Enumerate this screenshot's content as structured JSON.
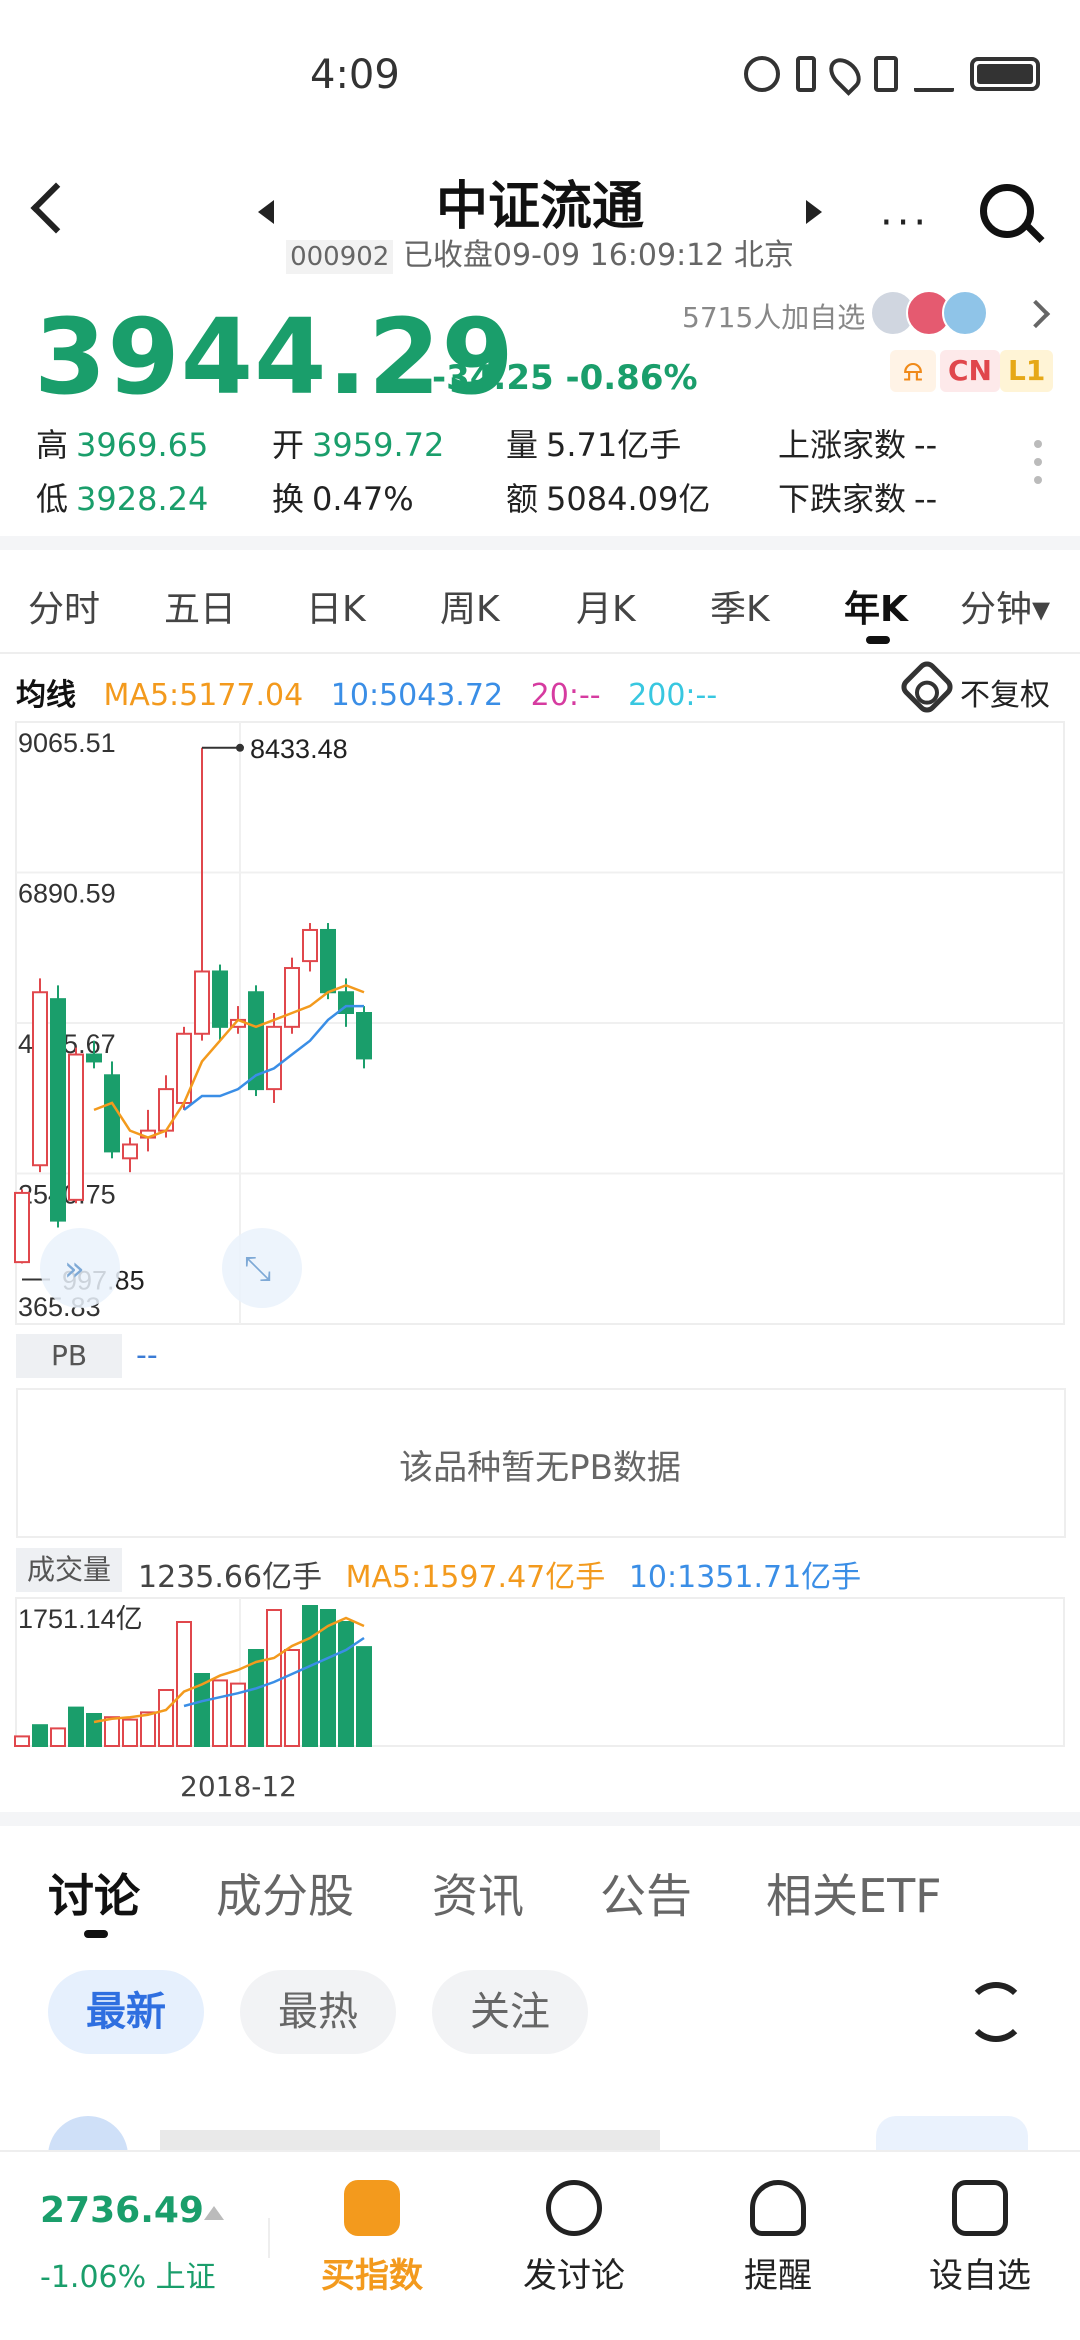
{
  "status_bar": {
    "time": "4:09",
    "icons": [
      "eye-icon",
      "bluetooth-icon",
      "location-icon",
      "vibrate-icon",
      "signal-5g-icon",
      "battery-icon"
    ]
  },
  "header": {
    "title": "中证流通",
    "code": "000902",
    "status": "已收盘09-09 16:09:12 北京",
    "more_label": "···"
  },
  "quote": {
    "price": "3944.29",
    "change": "-34.25 -0.86%",
    "followers": "5715人加自选",
    "tags": [
      "CN",
      "L1"
    ],
    "stats": [
      {
        "label": "高",
        "value": "3969.65"
      },
      {
        "label": "开",
        "value": "3959.72"
      },
      {
        "label": "量",
        "value": "5.71亿手"
      },
      {
        "label": "上涨家数",
        "value": "--"
      },
      {
        "label": "低",
        "value": "3928.24"
      },
      {
        "label": "换",
        "value": "0.47%"
      },
      {
        "label": "额",
        "value": "5084.09亿"
      },
      {
        "label": "下跌家数",
        "value": "--"
      }
    ]
  },
  "period_tabs": [
    "分时",
    "五日",
    "日K",
    "周K",
    "月K",
    "季K",
    "年K",
    "分钟▾"
  ],
  "ma_legend": {
    "title": "均线",
    "ma5": "MA5:5177.04",
    "ma10": "10:5043.72",
    "ma20": "20:--",
    "ma200": "200:--",
    "adjust": "不复权"
  },
  "chart_data": [
    {
      "type": "candlestick",
      "title": "年K",
      "y_ticks": [
        "9065.51",
        "6890.59",
        "4715.67",
        "2540.75",
        "365.83"
      ],
      "ylim": [
        365.83,
        9065.51
      ],
      "annotations": [
        {
          "label": "8433.48",
          "kind": "high"
        },
        {
          "label": "997.85",
          "kind": "low"
        }
      ],
      "candles": [
        {
          "o": 1000,
          "c": 2000,
          "h": 2050,
          "l": 980
        },
        {
          "o": 2400,
          "c": 4900,
          "h": 5100,
          "l": 2300
        },
        {
          "o": 4800,
          "c": 1600,
          "h": 5000,
          "l": 1500
        },
        {
          "o": 1900,
          "c": 4000,
          "h": 4100,
          "l": 1850
        },
        {
          "o": 4000,
          "c": 3900,
          "h": 4200,
          "l": 3800
        },
        {
          "o": 3700,
          "c": 2600,
          "h": 3900,
          "l": 2500
        },
        {
          "o": 2500,
          "c": 2700,
          "h": 2800,
          "l": 2300
        },
        {
          "o": 2800,
          "c": 2900,
          "h": 3200,
          "l": 2600
        },
        {
          "o": 2900,
          "c": 3500,
          "h": 3700,
          "l": 2800
        },
        {
          "o": 3300,
          "c": 4300,
          "h": 4400,
          "l": 3200
        },
        {
          "o": 4300,
          "c": 5200,
          "h": 8433,
          "l": 4200
        },
        {
          "o": 5200,
          "c": 4400,
          "h": 5300,
          "l": 4200
        },
        {
          "o": 4400,
          "c": 4500,
          "h": 4700,
          "l": 4300
        },
        {
          "o": 4900,
          "c": 3500,
          "h": 5000,
          "l": 3400
        },
        {
          "o": 3500,
          "c": 4400,
          "h": 4600,
          "l": 3300
        },
        {
          "o": 4400,
          "c": 5250,
          "h": 5400,
          "l": 4300
        },
        {
          "o": 5350,
          "c": 5800,
          "h": 5900,
          "l": 5200
        },
        {
          "o": 5800,
          "c": 4900,
          "h": 5900,
          "l": 4800
        },
        {
          "o": 4900,
          "c": 4600,
          "h": 5100,
          "l": 4400
        },
        {
          "o": 4600,
          "c": 3944,
          "h": 4700,
          "l": 3800
        }
      ],
      "ma5": [
        null,
        null,
        null,
        null,
        3200,
        3300,
        2900,
        2800,
        2900,
        3300,
        3900,
        4200,
        4500,
        4400,
        4500,
        4600,
        4700,
        4900,
        5000,
        4900
      ],
      "ma10": [
        null,
        null,
        null,
        null,
        null,
        null,
        null,
        null,
        null,
        3200,
        3400,
        3400,
        3500,
        3700,
        3800,
        4000,
        4200,
        4500,
        4700,
        4700
      ]
    },
    {
      "type": "bar",
      "title": "成交量",
      "y_ticks": [
        "1751.14亿"
      ],
      "volumes": [
        120,
        260,
        220,
        480,
        400,
        360,
        330,
        420,
        700,
        1550,
        900,
        820,
        780,
        1200,
        1700,
        1200,
        1750,
        1700,
        1550,
        1236
      ],
      "ups": [
        true,
        false,
        true,
        false,
        false,
        true,
        true,
        true,
        true,
        true,
        false,
        true,
        true,
        false,
        true,
        true,
        false,
        false,
        false,
        false
      ],
      "ma5_line": [
        null,
        null,
        null,
        null,
        300,
        340,
        360,
        390,
        450,
        680,
        770,
        880,
        950,
        1050,
        1100,
        1250,
        1350,
        1500,
        1600,
        1500
      ],
      "ma10_line": [
        null,
        null,
        null,
        null,
        null,
        null,
        null,
        null,
        null,
        500,
        560,
        610,
        660,
        720,
        800,
        900,
        1000,
        1100,
        1200,
        1350
      ],
      "x_label": "2018-12",
      "legend": {
        "title": "成交量",
        "current": "1235.66亿手",
        "ma5": "MA5:1597.47亿手",
        "ma10": "10:1351.71亿手"
      }
    }
  ],
  "pb": {
    "label": "PB",
    "value": "--",
    "empty_text": "该品种暂无PB数据"
  },
  "colors": {
    "up": "#e0474c",
    "down": "#1a9e6b",
    "ma5": "#f39a1d",
    "ma10": "#3a8ee6",
    "ma20": "#d63ba0",
    "ma200": "#38c7e0"
  },
  "discuss_tabs": [
    "讨论",
    "成分股",
    "资讯",
    "公告",
    "相关ETF"
  ],
  "filter_pills": [
    "最新",
    "最热",
    "关注"
  ],
  "bottom_bar": {
    "index_value": "2736.49",
    "index_change": "-1.06% 上证",
    "nav": [
      {
        "label": "买指数",
        "icon": "trend-chart-icon"
      },
      {
        "label": "发讨论",
        "icon": "chat-bubble-icon"
      },
      {
        "label": "提醒",
        "icon": "alarm-bell-icon"
      },
      {
        "label": "设自选",
        "icon": "add-watchlist-icon"
      }
    ]
  }
}
